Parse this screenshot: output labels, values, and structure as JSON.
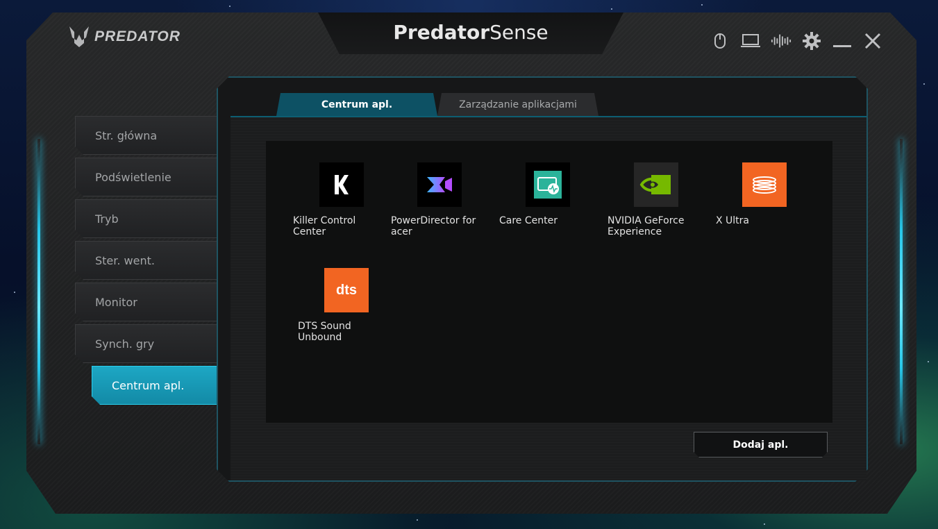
{
  "brand": {
    "logo_text": "PREDATOR"
  },
  "title": {
    "part1": "Predator",
    "part2": "Sense"
  },
  "window_controls": [
    "mouse-icon",
    "laptop-icon",
    "audio-wave-icon",
    "gear-icon",
    "minimize-icon",
    "close-icon"
  ],
  "sidebar": {
    "items": [
      {
        "label": "Str. główna"
      },
      {
        "label": "Podświetlenie"
      },
      {
        "label": "Tryb"
      },
      {
        "label": "Ster. went."
      },
      {
        "label": "Monitor"
      },
      {
        "label": "Synch. gry"
      },
      {
        "label": "Centrum apl.",
        "active": true
      }
    ]
  },
  "tabs": [
    {
      "label": "Centrum apl.",
      "active": true
    },
    {
      "label": "Zarządzanie aplikacjami",
      "active": false
    }
  ],
  "apps": [
    {
      "label": "Killer Control Center",
      "icon": "killer-icon",
      "color": "#000000"
    },
    {
      "label": "PowerDirector for acer",
      "icon": "powerdirector-icon",
      "color": "#000000"
    },
    {
      "label": "Care Center",
      "icon": "care-center-icon",
      "color": "#2bb39a"
    },
    {
      "label": "NVIDIA GeForce Experience",
      "icon": "nvidia-icon",
      "color": "#262626"
    },
    {
      "label": "X Ultra",
      "icon": "x-ultra-icon",
      "color": "#f26522"
    },
    {
      "label": "DTS Sound Unbound",
      "icon": "dts-icon",
      "color": "#f26522"
    }
  ],
  "add_button": {
    "label": "Dodaj apl."
  },
  "colors": {
    "accent": "#1da7c4",
    "tab_active": "#0d5164",
    "frame": "#1f5462"
  }
}
